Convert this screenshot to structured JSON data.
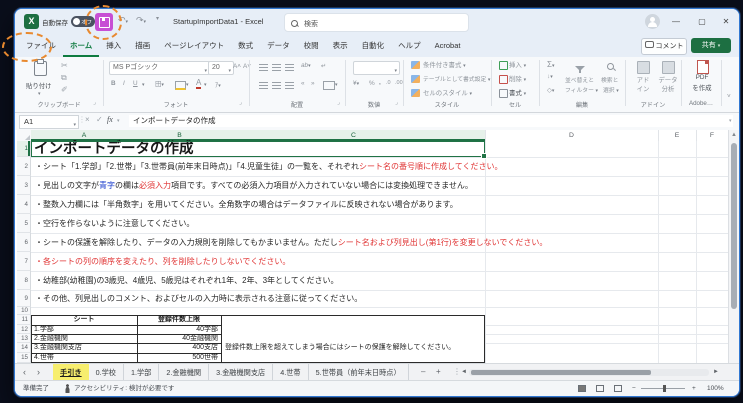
{
  "annotations": {
    "highlight_color": "#e8892f",
    "save_highlight_color": "#c74fd4"
  },
  "title_bar": {
    "autosave_label": "自動保存",
    "autosave_state": "オフ",
    "title": "StartupImportData1 - Excel",
    "search_placeholder": "検索"
  },
  "window_controls": {
    "comment": "コメント",
    "share": "共有"
  },
  "menu_tabs": [
    "ファイル",
    "ホーム",
    "挿入",
    "描画",
    "ページレイアウト",
    "数式",
    "データ",
    "校閲",
    "表示",
    "自動化",
    "ヘルプ",
    "Acrobat"
  ],
  "active_menu_tab": "ホーム",
  "ribbon": {
    "paste": "貼り付け",
    "clipboard_group": "クリップボード",
    "font_name": "MS Pゴシック",
    "font_size": "20",
    "bold": "B",
    "italic": "I",
    "underline": "U",
    "font_group": "フォント",
    "align_group": "配置",
    "number_group": "数値",
    "conditional": "条件付き書式",
    "format_table": "テーブルとして書式設定",
    "cell_styles": "セルのスタイル",
    "styles_group": "スタイル",
    "insert": "挿入",
    "delete": "削除",
    "format": "書式",
    "cells_group": "セル",
    "sort_line1": "並べ替えと",
    "sort_line2": "フィルター",
    "find_line1": "検索と",
    "find_line2": "選択",
    "editing_group": "編集",
    "addin_line1": "アド",
    "addin_line2": "イン",
    "data_analysis_line1": "データ",
    "data_analysis_line2": "分析",
    "addins_group": "アドイン",
    "pdf_line1": "PDF",
    "pdf_line2": "を作成",
    "adobe_group": "Adobe…"
  },
  "formula_bar": {
    "name_box": "A1",
    "fx": "fx",
    "content": "インポートデータの作成"
  },
  "grid": {
    "col_headers": [
      "A",
      "B",
      "C",
      "D",
      "E",
      "F"
    ],
    "row_headers": [
      "1",
      "2",
      "3",
      "4",
      "5",
      "6",
      "7",
      "8",
      "9",
      "10",
      "11",
      "12",
      "13",
      "14",
      "15"
    ],
    "title": "インポートデータの作成",
    "notes": [
      {
        "row": 2,
        "segments": [
          {
            "text": "・シート「1.学部」「2.世帯」「3.世帯員(前年末日時点)」「4.児童生徒」の一覧を、それぞれ",
            "color": "def"
          },
          {
            "text": "シート名の番号順に作成してください。",
            "color": "red"
          }
        ]
      },
      {
        "row": 3,
        "segments": [
          {
            "text": "・見出しの文字が",
            "color": "def"
          },
          {
            "text": "青字",
            "color": "blue"
          },
          {
            "text": "の欄は",
            "color": "def"
          },
          {
            "text": "必須入力",
            "color": "red"
          },
          {
            "text": "項目です。すべての必須入力項目が入力されていない場合には変換処理できません。",
            "color": "def"
          }
        ]
      },
      {
        "row": 4,
        "segments": [
          {
            "text": "・整数入力欄には「半角数字」を用いてください。全角数字の場合はデータファイルに反映されない場合があります。",
            "color": "def"
          }
        ]
      },
      {
        "row": 5,
        "segments": [
          {
            "text": "・空行を作らないように注意してください。",
            "color": "def"
          }
        ]
      },
      {
        "row": 6,
        "segments": [
          {
            "text": "・シートの保護を解除したり、データの入力規則を削除してもかまいません。ただし",
            "color": "def"
          },
          {
            "text": "シート名および列見出し(第1行)を変更しないでください。",
            "color": "red"
          }
        ]
      },
      {
        "row": 7,
        "segments": [
          {
            "text": "・各シートの列の順序を変えたり、列を削除したりしないでください。",
            "color": "red"
          }
        ]
      },
      {
        "row": 8,
        "segments": [
          {
            "text": "・幼稚部(幼稚園)の3歳児、4歳児、5歳児はそれぞれ1年、2年、3年としてください。",
            "color": "def"
          }
        ]
      },
      {
        "row": 9,
        "segments": [
          {
            "text": "・その他、列見出しのコメント、およびセルの入力時に表示される注意に従ってください。",
            "color": "def"
          }
        ]
      }
    ],
    "table": {
      "headers": [
        "シート",
        "登録件数上限"
      ],
      "rows": [
        [
          "1.学部",
          "40学部"
        ],
        [
          "2.金融機関",
          "40金融機関"
        ],
        [
          "3.金融機関支店",
          "400支店"
        ],
        [
          "4.世帯",
          "500世帯"
        ]
      ],
      "side_note": "登録件数上限を超えてしまう場合にはシートの保護を解除してください。"
    }
  },
  "sheet_tabs": {
    "tabs": [
      "手引き",
      "0.学校",
      "1.学部",
      "2.金融機関",
      "3.金融機関支店",
      "4.世帯",
      "5.世帯員（前年末日時点）"
    ],
    "active": "手引き"
  },
  "status_bar": {
    "ready": "準備完了",
    "accessibility": "アクセシビリティ: 検討が必要です",
    "zoom": "100%"
  }
}
